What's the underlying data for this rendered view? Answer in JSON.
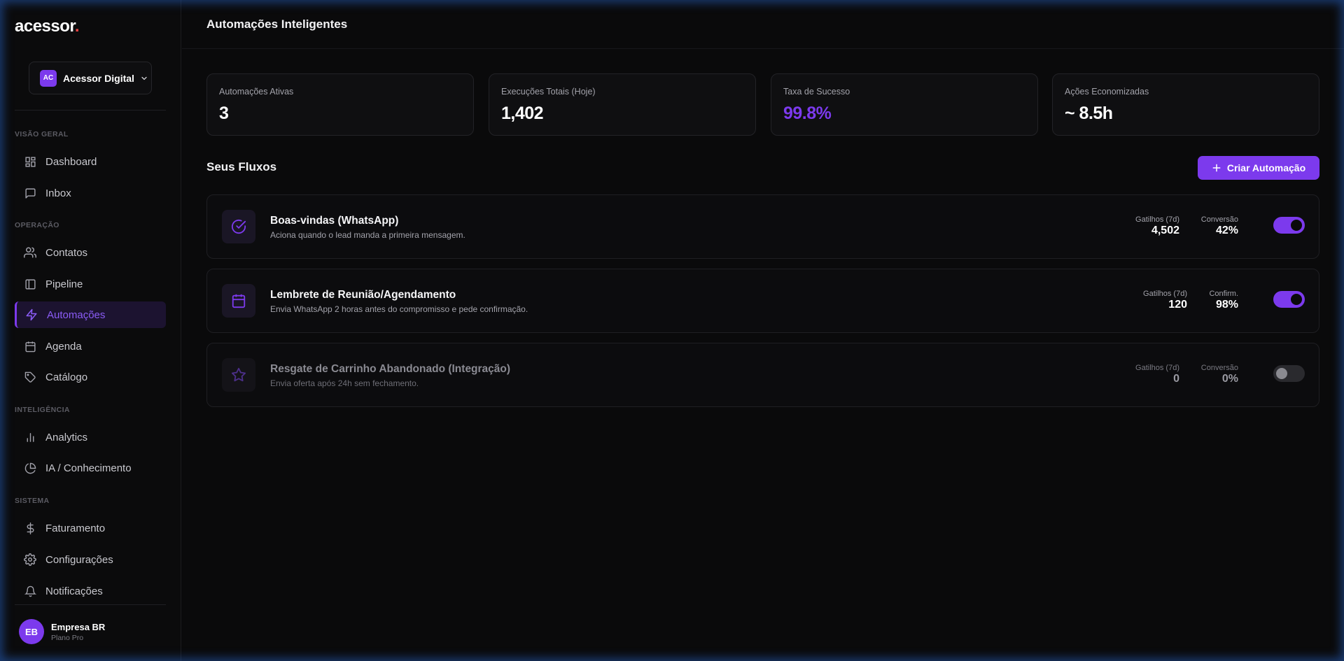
{
  "brand": {
    "name": "acessor",
    "dot": ".",
    "dot_color": "#ef4444"
  },
  "accent": "#7c3aed",
  "workspace": {
    "badge": "AC",
    "name": "Acessor Digital"
  },
  "nav_sections": {
    "overview": "VISÃO GERAL",
    "operation": "OPERAÇÃO",
    "intelligence": "INTELIGÊNCIA",
    "system": "SISTEMA"
  },
  "nav": {
    "dashboard": "Dashboard",
    "inbox": "Inbox",
    "contacts": "Contatos",
    "pipeline": "Pipeline",
    "automations": "Automações",
    "agenda": "Agenda",
    "catalog": "Catálogo",
    "analytics": "Analytics",
    "ai": "IA / Conhecimento",
    "billing": "Faturamento",
    "settings": "Configurações",
    "notifications": "Notificações"
  },
  "user": {
    "initials": "EB",
    "name": "Empresa BR",
    "plan": "Plano Pro"
  },
  "header": {
    "title": "Automações Inteligentes"
  },
  "stats": [
    {
      "label": "Automações Ativas",
      "value": "3"
    },
    {
      "label": "Execuções Totais (Hoje)",
      "value": "1,402"
    },
    {
      "label": "Taxa de Sucesso",
      "value": "99.8%",
      "color": "#7c3aed"
    },
    {
      "label": "Ações Economizadas",
      "value": "~ 8.5h"
    }
  ],
  "flows_section": {
    "title": "Seus Fluxos",
    "create_label": "Criar Automação"
  },
  "flows": [
    {
      "icon": "check-circle-icon",
      "title": "Boas-vindas (WhatsApp)",
      "desc": "Aciona quando o lead manda a primeira mensagem.",
      "m1_label": "Gatilhos (7d)",
      "m1_value": "4,502",
      "m2_label": "Conversão",
      "m2_value": "42%",
      "enabled": true
    },
    {
      "icon": "calendar-icon",
      "title": "Lembrete de Reunião/Agendamento",
      "desc": "Envia WhatsApp 2 horas antes do compromisso e pede confirmação.",
      "m1_label": "Gatilhos (7d)",
      "m1_value": "120",
      "m2_label": "Confirm.",
      "m2_value": "98%",
      "enabled": true
    },
    {
      "icon": "star-icon",
      "title": "Resgate de Carrinho Abandonado (Integração)",
      "desc": "Envia oferta após 24h sem fechamento.",
      "m1_label": "Gatilhos (7d)",
      "m1_value": "0",
      "m2_label": "Conversão",
      "m2_value": "0%",
      "enabled": false
    }
  ]
}
